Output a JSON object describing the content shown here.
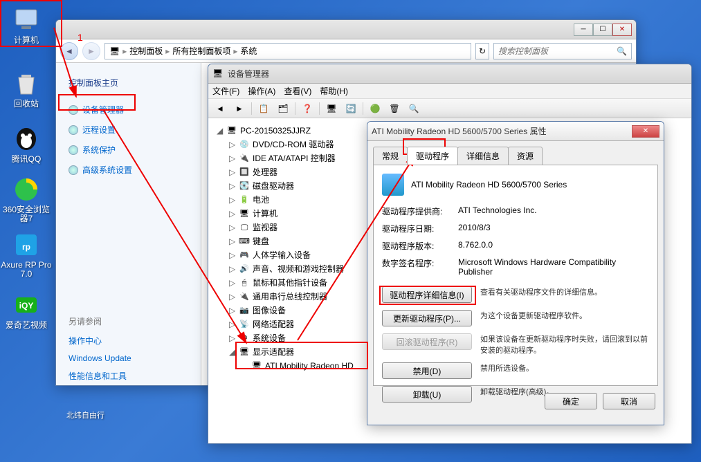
{
  "desktop": {
    "items": [
      {
        "label": "计算机",
        "color": "#bcd6f5"
      },
      {
        "label": "回收站",
        "color": "#e5e5e5"
      },
      {
        "label": "腾讯QQ",
        "color": "#2fa0e8"
      },
      {
        "label": "360安全浏览器7",
        "color": "#2ec14b"
      },
      {
        "label": "Axure RP Pro 7.0",
        "color": "#1fa2e6"
      },
      {
        "label": "爱奇艺视频",
        "color": "#17b01a"
      }
    ],
    "desktop_extra": "北纬自由行"
  },
  "main_window": {
    "breadcrumb": [
      "控制面板",
      "所有控制面板项",
      "系统"
    ],
    "search_placeholder": "搜索控制面板",
    "sidebar": {
      "home": "控制面板主页",
      "links": [
        "设备管理器",
        "远程设置",
        "系统保护",
        "高级系统设置"
      ],
      "see_also_head": "另请参阅",
      "see_also": [
        "操作中心",
        "Windows Update",
        "性能信息和工具"
      ]
    }
  },
  "anno_number": "1",
  "devmgr": {
    "title": "设备管理器",
    "menu": [
      "文件(F)",
      "操作(A)",
      "查看(V)",
      "帮助(H)"
    ],
    "root": "PC-20150325JJRZ",
    "nodes": [
      "DVD/CD-ROM 驱动器",
      "IDE ATA/ATAPI 控制器",
      "处理器",
      "磁盘驱动器",
      "电池",
      "计算机",
      "监视器",
      "键盘",
      "人体学输入设备",
      "声音、视频和游戏控制器",
      "鼠标和其他指针设备",
      "通用串行总线控制器",
      "图像设备",
      "网络适配器",
      "系统设备",
      "显示适配器"
    ],
    "display_child": "ATI Mobility Radeon HD"
  },
  "props": {
    "title": "ATI Mobility Radeon HD 5600/5700 Series 属性",
    "tabs": [
      "常规",
      "驱动程序",
      "详细信息",
      "资源"
    ],
    "device_name": "ATI Mobility Radeon HD 5600/5700 Series",
    "rows": {
      "provider_l": "驱动程序提供商:",
      "provider_v": "ATI Technologies Inc.",
      "date_l": "驱动程序日期:",
      "date_v": "2010/8/3",
      "version_l": "驱动程序版本:",
      "version_v": "8.762.0.0",
      "signer_l": "数字签名程序:",
      "signer_v": "Microsoft Windows Hardware Compatibility Publisher"
    },
    "buttons": {
      "details": "驱动程序详细信息(I)",
      "details_desc": "查看有关驱动程序文件的详细信息。",
      "update": "更新驱动程序(P)...",
      "update_desc": "为这个设备更新驱动程序软件。",
      "rollback": "回滚驱动程序(R)",
      "rollback_desc": "如果该设备在更新驱动程序时失败，请回滚到以前安装的驱动程序。",
      "disable": "禁用(D)",
      "disable_desc": "禁用所选设备。",
      "uninstall": "卸载(U)",
      "uninstall_desc": "卸载驱动程序(高级)。"
    },
    "ok": "确定",
    "cancel": "取消"
  }
}
